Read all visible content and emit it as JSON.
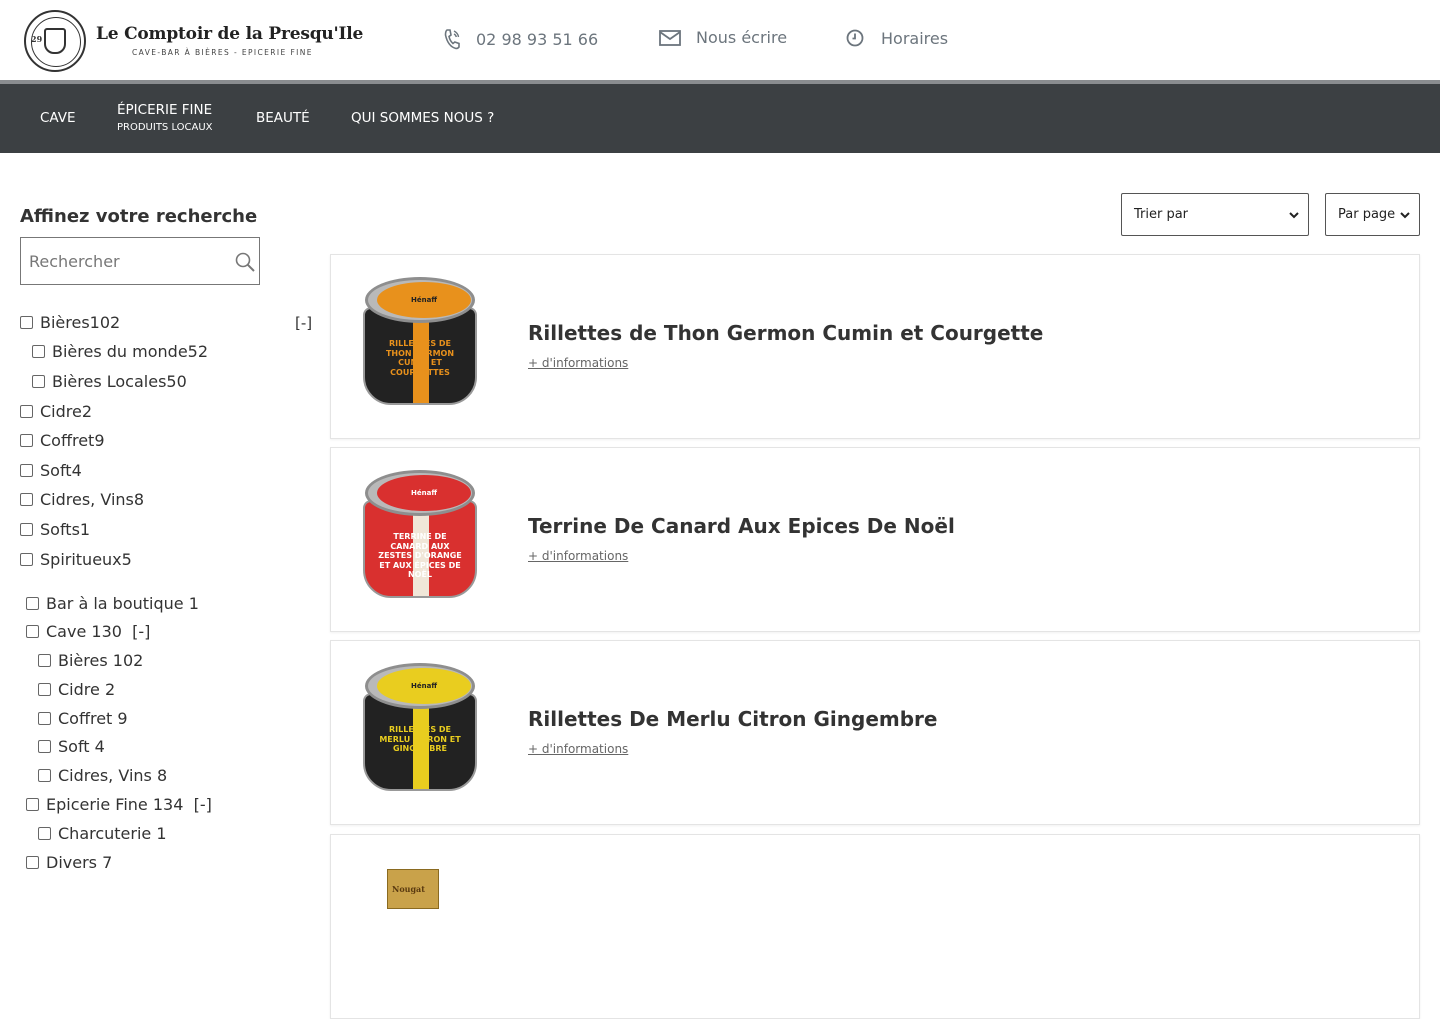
{
  "header": {
    "logo_title": "Le Comptoir de la Presqu'Ile",
    "logo_subtitle": "CAVE-BAR À BIÈRES - EPICERIE FINE",
    "logo_seal_number": "29",
    "phone": "02 98 93 51 66",
    "email_label": "Nous écrire",
    "hours_label": "Horaires"
  },
  "nav": {
    "cave": "CAVE",
    "epicerie": "ÉPICERIE FINE",
    "epicerie_sub": "PRODUITS LOCAUX",
    "beaute": "BEAUTÉ",
    "qui": "QUI SOMMES NOUS ?"
  },
  "sidebar": {
    "title": "Affinez votre recherche",
    "search_placeholder": "Rechercher",
    "collapse_label": "[-]",
    "filters_a": [
      {
        "label": "Bières",
        "count": "102"
      },
      {
        "label": "Bières du monde",
        "count": "52"
      },
      {
        "label": "Bières Locales",
        "count": "50"
      },
      {
        "label": "Cidre",
        "count": "2"
      },
      {
        "label": "Coffret",
        "count": "9"
      },
      {
        "label": "Soft",
        "count": "4"
      },
      {
        "label": "Cidres, Vins",
        "count": "8"
      },
      {
        "label": "Softs",
        "count": "1"
      },
      {
        "label": "Spiritueux",
        "count": "5"
      }
    ],
    "filters_b": [
      {
        "label": "Bar à la boutique",
        "count": "1"
      },
      {
        "label": "Cave",
        "count": "130"
      },
      {
        "label": "Bières",
        "count": "102"
      },
      {
        "label": "Cidre",
        "count": "2"
      },
      {
        "label": "Coffret",
        "count": "9"
      },
      {
        "label": "Soft",
        "count": "4"
      },
      {
        "label": "Cidres, Vins",
        "count": "8"
      },
      {
        "label": "Epicerie Fine",
        "count": "134"
      },
      {
        "label": "Charcuterie",
        "count": "1"
      },
      {
        "label": "Divers",
        "count": "7"
      }
    ]
  },
  "toolbar": {
    "sort_label": "Trier par",
    "per_page_label": "Par page"
  },
  "products": [
    {
      "title": "Rillettes de Thon Germon Cumin et Courgette",
      "link": "+ d'informations",
      "jar_label": "RILLETTES DE THON GERMON CUMIN ET COURGETTES",
      "brand": "Hénaff"
    },
    {
      "title": "Terrine De Canard Aux Epices De Noël",
      "link": "+ d'informations",
      "jar_label": "TERRINE DE CANARD AUX ZESTES D'ORANGE ET AUX ÉPICES DE NOËL",
      "brand": "Hénaff"
    },
    {
      "title": "Rillettes De Merlu Citron Gingembre",
      "link": "+ d'informations",
      "jar_label": "RILLETTES DE MERLU CITRON ET GINGEMBRE",
      "brand": "Hénaff"
    },
    {
      "title": "",
      "link": "",
      "jar_label": "Nougat",
      "brand": ""
    }
  ],
  "colors": {
    "nav_bg": "#3c4043",
    "accent_orange": "#e8911c",
    "accent_red": "#d9302f",
    "accent_yellow": "#e9cd1f"
  }
}
